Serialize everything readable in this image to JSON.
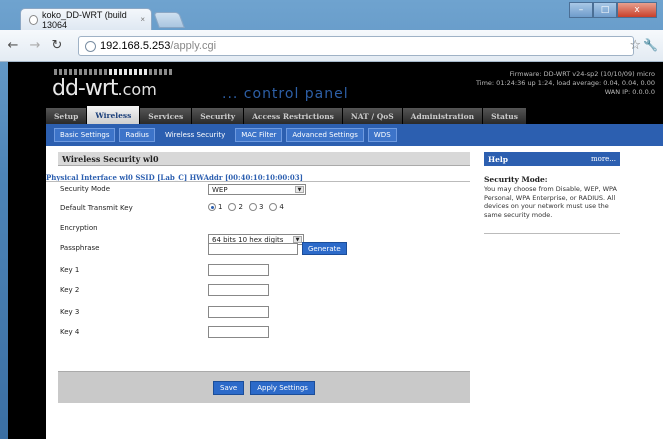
{
  "browser": {
    "tab_title": "koko_DD-WRT (build 13064",
    "tab_close": "×",
    "url_host": "192.168.5.253",
    "url_path": "/apply.cgi",
    "win_min": "–",
    "win_max": "□",
    "win_close": "x"
  },
  "header": {
    "logo_main": "dd-wrt",
    "logo_com": ".com",
    "cpanel": "... control panel",
    "firmware": "Firmware: DD-WRT v24-sp2 (10/10/09) micro",
    "time_load": "Time: 01:24:36 up 1:24, load average: 0.04, 0.04, 0.00",
    "wan_ip": "WAN IP: 0.0.0.0"
  },
  "main_tabs": [
    {
      "label": "Setup"
    },
    {
      "label": "Wireless"
    },
    {
      "label": "Services"
    },
    {
      "label": "Security"
    },
    {
      "label": "Access Restrictions"
    },
    {
      "label": "NAT / QoS"
    },
    {
      "label": "Administration"
    },
    {
      "label": "Status"
    }
  ],
  "sub_tabs": [
    {
      "label": "Basic Settings"
    },
    {
      "label": "Radius"
    },
    {
      "label": "Wireless Security"
    },
    {
      "label": "MAC Filter"
    },
    {
      "label": "Advanced Settings"
    },
    {
      "label": "WDS"
    }
  ],
  "panel": {
    "title": "Wireless Security wl0",
    "interface": "Physical Interface wl0 SSID [Lab_C] HWAddr [00:40:10:10:00:03]",
    "security_mode_label": "Security Mode",
    "security_mode_value": "WEP",
    "transmit_key_label": "Default Transmit Key",
    "transmit_keys": [
      "1",
      "2",
      "3",
      "4"
    ],
    "encryption_label": "Encryption",
    "encryption_value": "64 bits 10 hex digits",
    "passphrase_label": "Passphrase",
    "generate_label": "Generate",
    "key1_label": "Key 1",
    "key2_label": "Key 2",
    "key3_label": "Key 3",
    "key4_label": "Key 4"
  },
  "footer": {
    "save_label": "Save",
    "apply_label": "Apply Settings"
  },
  "help": {
    "title": "Help",
    "more": "more...",
    "heading": "Security Mode:",
    "body": "You may choose from Disable, WEP, WPA Personal, WPA Enterprise, or RADIUS. All devices on your network must use the same security mode."
  }
}
